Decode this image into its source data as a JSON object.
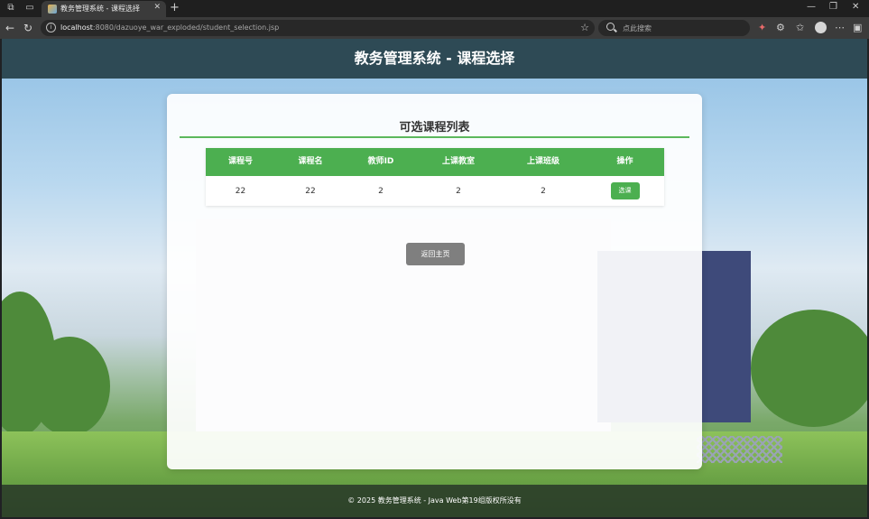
{
  "browser": {
    "tab_title": "教务管理系统 - 课程选择",
    "url_host": "localhost",
    "url_rest": ":8080/dazuoye_war_exploded/student_selection.jsp",
    "search_placeholder": "点此搜索"
  },
  "header": {
    "title": "教务管理系统 - 课程选择"
  },
  "card": {
    "title": "可选课程列表",
    "columns": [
      "课程号",
      "课程名",
      "教师ID",
      "上课教室",
      "上课班级",
      "操作"
    ],
    "rows": [
      {
        "course_id": "22",
        "course_name": "22",
        "teacher_id": "2",
        "classroom": "2",
        "class": "2",
        "action": "选课"
      }
    ],
    "back_label": "返回主页"
  },
  "footer": {
    "text": "© 2025 教务管理系统 - Java Web第19组版权所没有"
  },
  "colors": {
    "header": "#2e4a55",
    "accent": "#4caf50",
    "back_button": "#7f7f7f"
  }
}
